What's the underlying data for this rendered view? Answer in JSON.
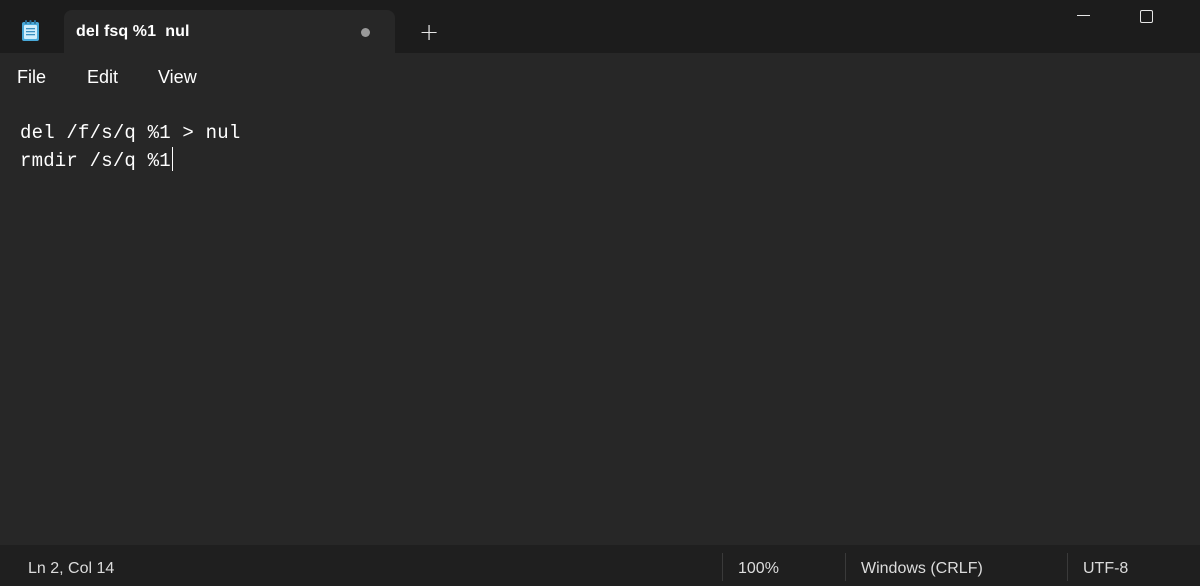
{
  "app": {
    "icon": "notepad-icon"
  },
  "tab": {
    "title": "del fsq %1  nul",
    "unsaved_indicator": "dot"
  },
  "titlebar": {
    "new_tab_glyph": "+",
    "minimize_icon": "minimize-icon",
    "maximize_icon": "maximize-icon"
  },
  "menu": {
    "file": "File",
    "edit": "Edit",
    "view": "View"
  },
  "editor": {
    "lines": [
      "del /f/s/q %1 > nul",
      "rmdir /s/q %1"
    ]
  },
  "status": {
    "position": "Ln 2, Col 14",
    "zoom": "100%",
    "line_ending": "Windows (CRLF)",
    "encoding": "UTF-8"
  },
  "colors": {
    "titlebar_bg": "#1c1c1c",
    "editor_bg": "#272727",
    "statusbar_bg": "#1f1f1f",
    "icon_accent": "#5bc0eb"
  }
}
